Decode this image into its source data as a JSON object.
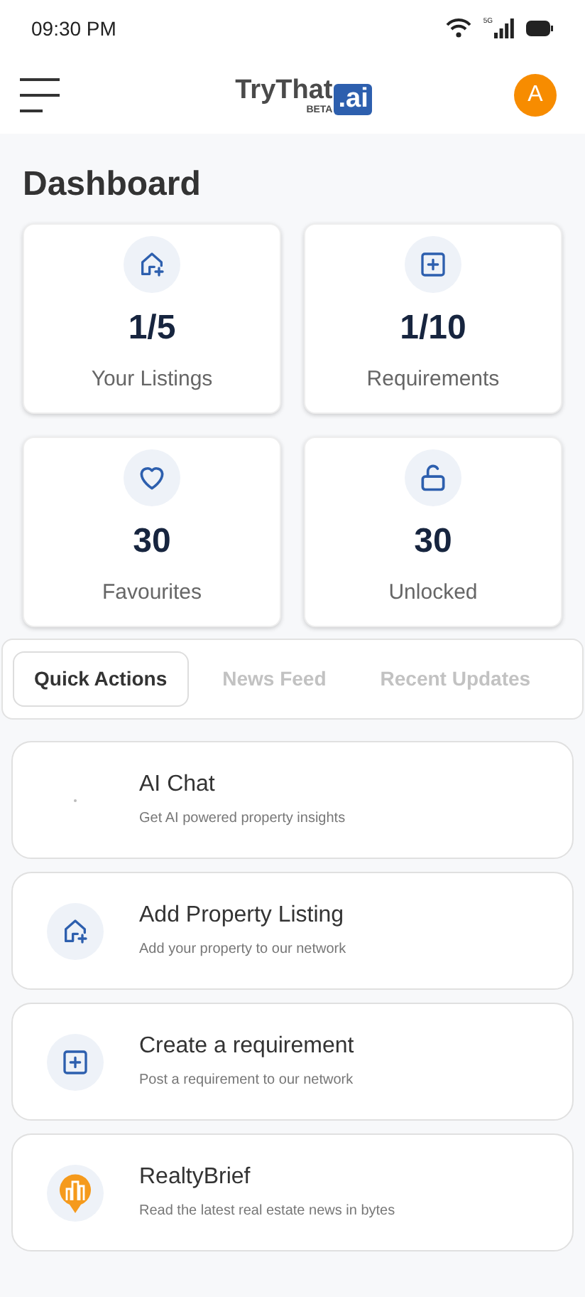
{
  "status_bar": {
    "time": "09:30 PM",
    "network": "5G"
  },
  "header": {
    "logo": {
      "name": "TryThat",
      "badge": "BETA",
      "suffix": ".ai"
    },
    "avatar": "A"
  },
  "title": "Dashboard",
  "stats": [
    {
      "kind": "listing",
      "value": "1/5",
      "label": "Your Listings"
    },
    {
      "kind": "requirement",
      "value": "1/10",
      "label": "Requirements"
    },
    {
      "kind": "favourite",
      "value": "30",
      "label": "Favourites"
    },
    {
      "kind": "unlocked",
      "value": "30",
      "label": "Unlocked"
    }
  ],
  "tabs": [
    {
      "label": "Quick Actions",
      "selected": true
    },
    {
      "label": "News Feed",
      "selected": false
    },
    {
      "label": "Recent Updates",
      "selected": false
    }
  ],
  "actions": [
    {
      "kind": "chat",
      "title": "AI Chat",
      "subtitle": "Get AI powered property insights"
    },
    {
      "kind": "listing",
      "title": "Add Property Listing",
      "subtitle": "Add your property to our network"
    },
    {
      "kind": "requirement",
      "title": "Create a requirement",
      "subtitle": "Post a requirement to our network"
    },
    {
      "kind": "news",
      "title": "RealtyBrief",
      "subtitle": "Read the latest real estate news in bytes"
    }
  ]
}
